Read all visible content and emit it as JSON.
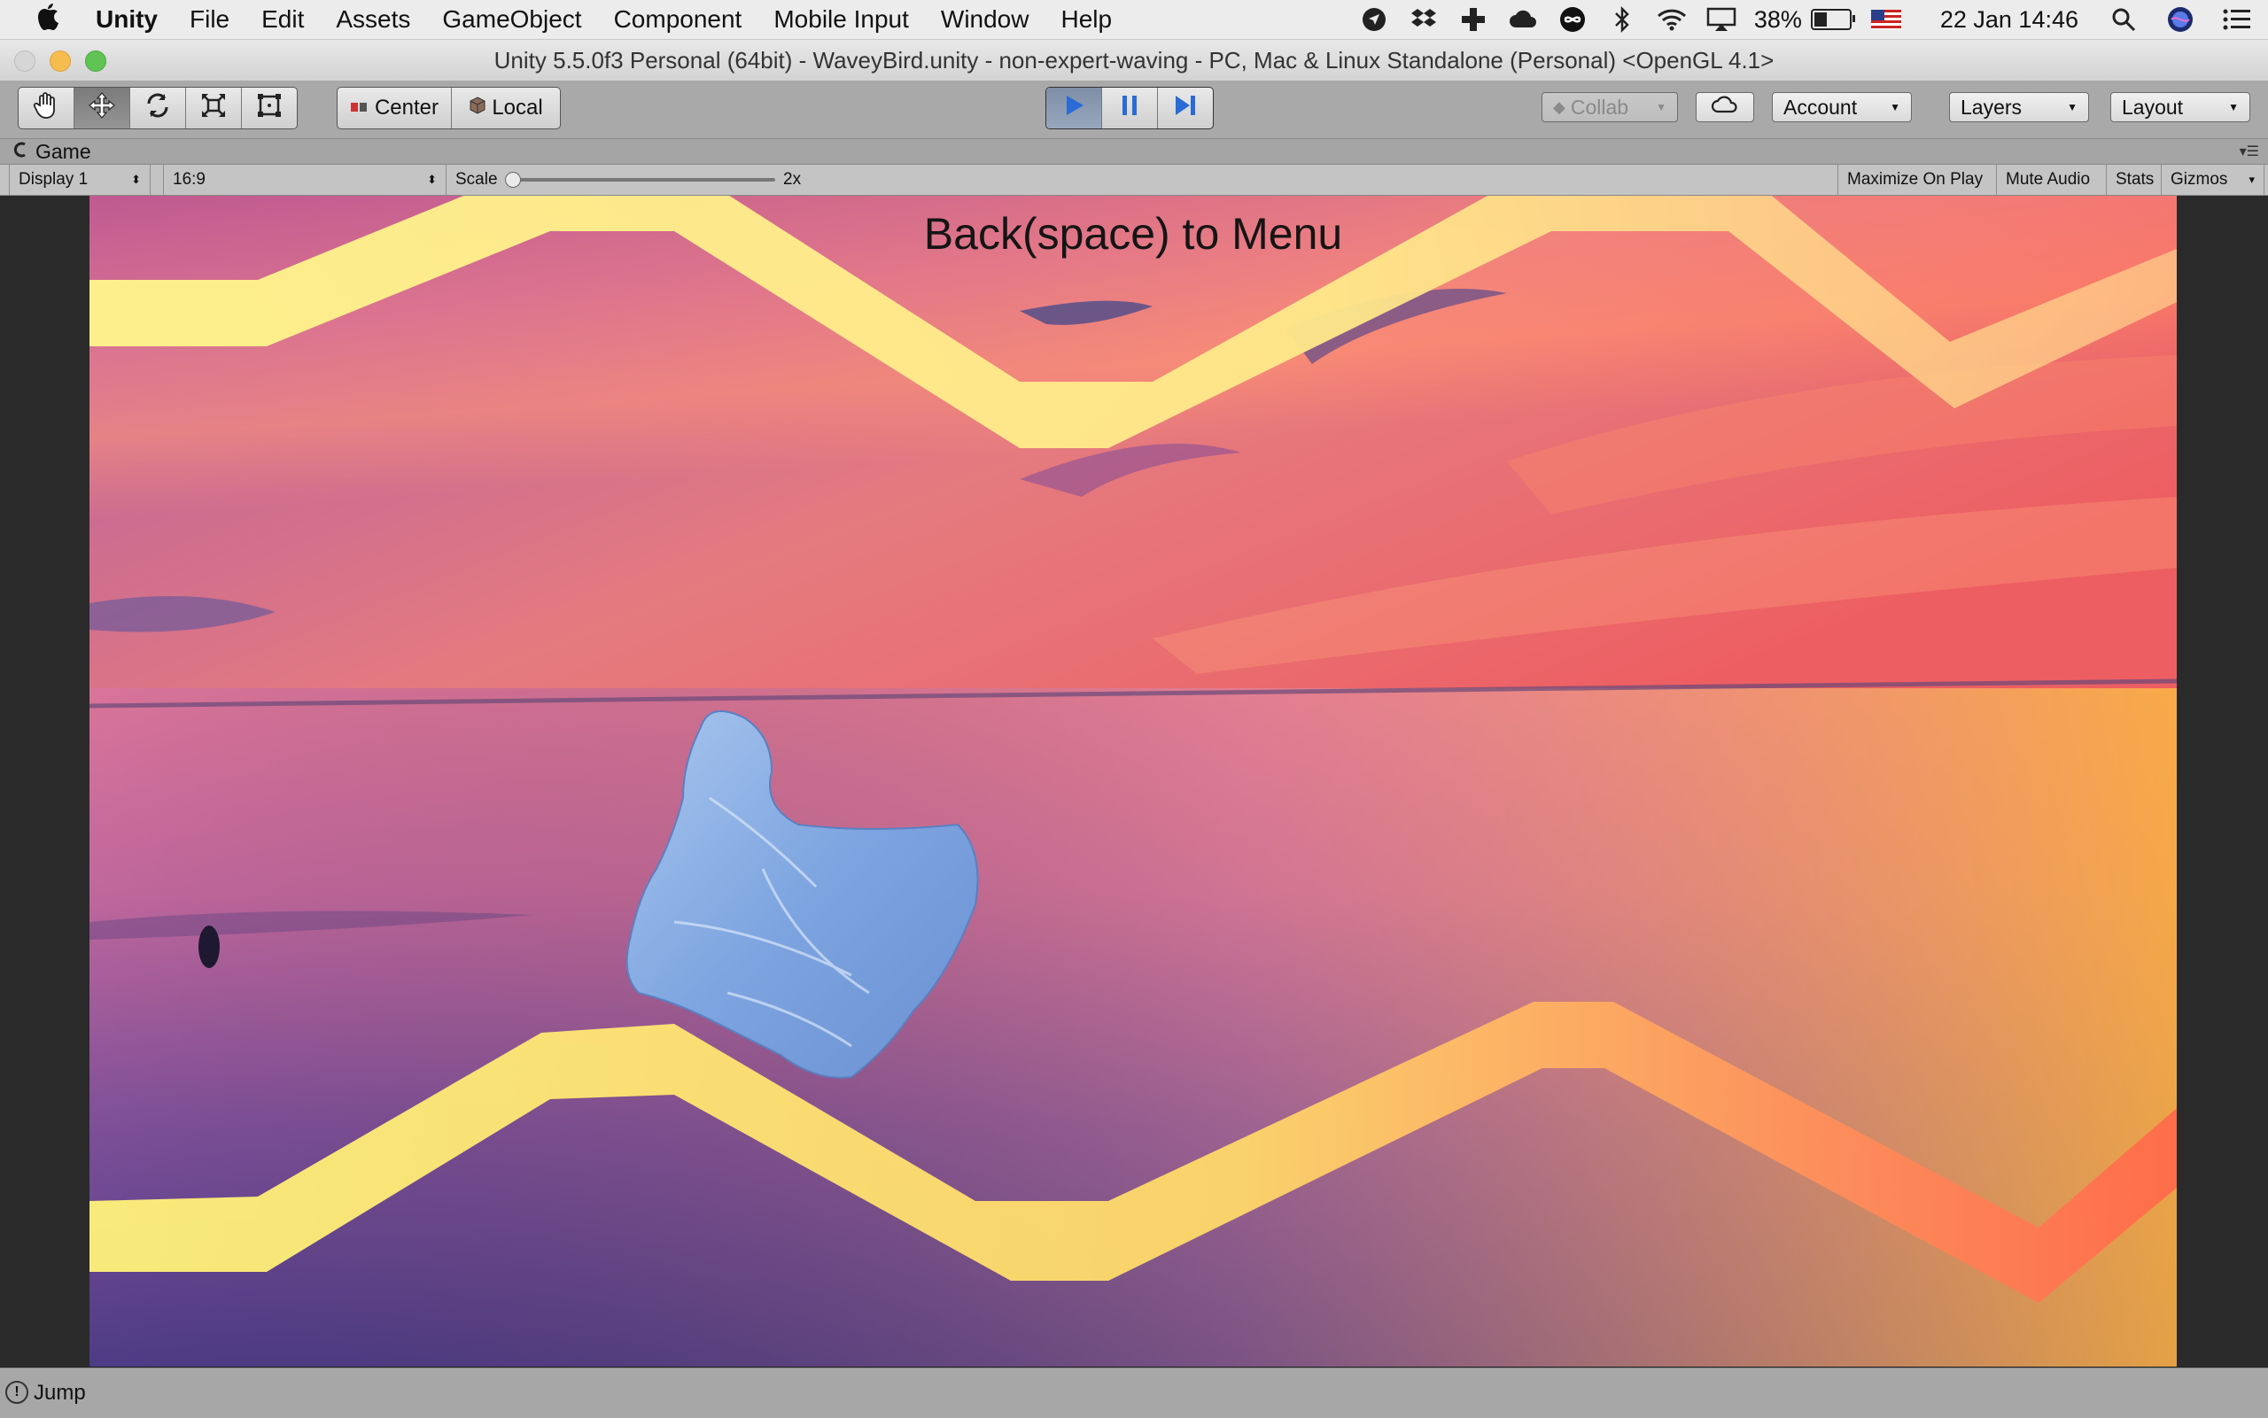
{
  "menubar": {
    "app_name": "Unity",
    "items": [
      "File",
      "Edit",
      "Assets",
      "GameObject",
      "Component",
      "Mobile Input",
      "Window",
      "Help"
    ],
    "battery": "38%",
    "battery_level": 0.38,
    "datetime": "22 Jan  14:46",
    "tray_icons": [
      "location-icon",
      "dropbox-icon",
      "plus-icon",
      "creative-cloud-icon",
      "infinity-icon",
      "bluetooth-icon",
      "wifi-icon",
      "airplay-icon"
    ]
  },
  "window": {
    "title": "Unity 5.5.0f3 Personal (64bit) - WaveyBird.unity - non-expert-waving - PC, Mac & Linux Standalone (Personal) <OpenGL 4.1>"
  },
  "toolbar": {
    "transform_tools": [
      "hand-tool-icon",
      "move-tool-icon",
      "rotate-tool-icon",
      "scale-tool-icon",
      "rect-tool-icon"
    ],
    "pivot_mode": "Center",
    "pivot_rotation": "Local",
    "play_controls": [
      "play-icon",
      "pause-icon",
      "step-icon"
    ],
    "collab": "Collab",
    "account": "Account",
    "layers": "Layers",
    "layout": "Layout"
  },
  "game_panel": {
    "tab_label": "Game",
    "display": "Display 1",
    "aspect": "16:9",
    "scale_label": "Scale",
    "scale_value": "2x",
    "maximize_on_play": "Maximize On Play",
    "mute_audio": "Mute Audio",
    "stats": "Stats",
    "gizmos": "Gizmos"
  },
  "game": {
    "hud_text": "Back(space) to Menu"
  },
  "status": {
    "message": "Jump"
  },
  "colors": {
    "menubar_bg": "#ececec",
    "toolbar_bg": "#a9a9a9",
    "play_active": "#2a6bd6",
    "wave_yellow": "#fff48a",
    "wave_orange": "#ff7a5a"
  }
}
